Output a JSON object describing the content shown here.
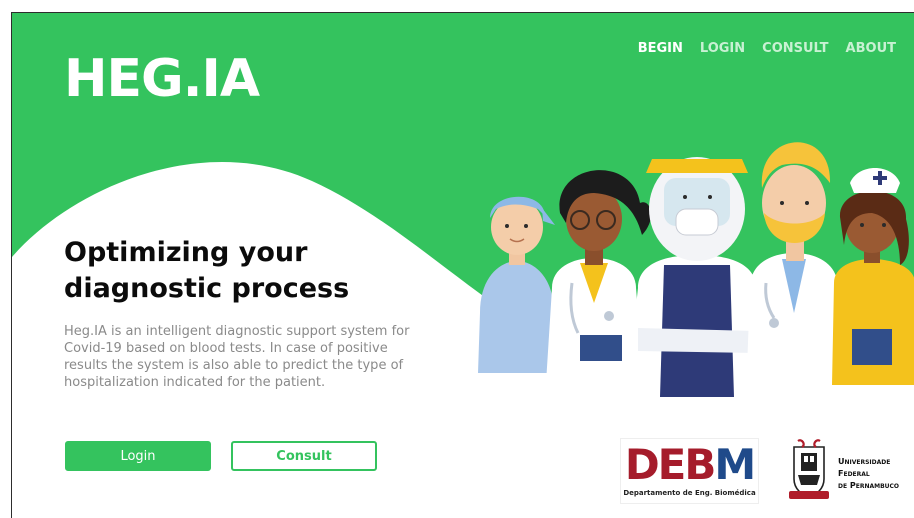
{
  "brand": {
    "name": "HEG.IA"
  },
  "nav": {
    "items": [
      {
        "label": "BEGIN",
        "active": true
      },
      {
        "label": "LOGIN",
        "active": false
      },
      {
        "label": "CONSULT",
        "active": false
      },
      {
        "label": "ABOUT",
        "active": false
      }
    ]
  },
  "hero": {
    "title_line1": "Optimizing your",
    "title_line2": "diagnostic process",
    "description": "Heg.IA is an intelligent diagnostic support system for Covid-19 based on blood tests. In case of positive results the system is also able to predict the type of hospitalization indicated for the patient.",
    "login_label": "Login",
    "consult_label": "Consult"
  },
  "logos": {
    "debm_part1": "DEB",
    "debm_part2": "M",
    "debm_subtitle": "Departamento de Eng. Biomédica",
    "ufpe_line1": "Universidade",
    "ufpe_line2": "Federal",
    "ufpe_line3": "de Pernambuco"
  },
  "colors": {
    "brand_green": "#34c35e",
    "debm_red": "#a51c2b",
    "debm_blue": "#1f4a8a"
  },
  "icons": {
    "illustration": "healthcare-workers-illustration",
    "emblem": "ufpe-emblem-icon"
  }
}
